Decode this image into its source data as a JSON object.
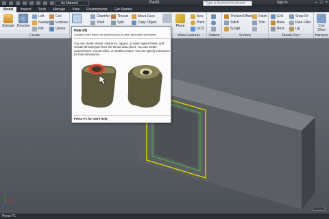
{
  "titlebar": {
    "material": "As Material",
    "document": "Part3",
    "search_placeholder": "Type a keyword or phrase",
    "sign_in": "Sign In"
  },
  "tabs": [
    "Model",
    "Inspect",
    "Tools",
    "Manage",
    "View",
    "Environments",
    "Get Started"
  ],
  "ribbon": {
    "create_title": "Create",
    "extrude": "Extrude",
    "revolve": "Revolve",
    "loft": "Loft",
    "sweep": "Sweep",
    "rib": "Rib",
    "coil": "Coil",
    "emboss": "Emboss",
    "derive": "Derive",
    "chamfer": "Chamfer",
    "thread": "Thread",
    "move_face": "Move Face",
    "shell": "Shell",
    "split": "Split",
    "copy_object": "Copy Object",
    "axis": "Axis",
    "point": "Point",
    "ucs": "UCS",
    "plane": "Plane",
    "work_features_title": "Work Features",
    "pattern_title": "Pattern",
    "thicken_offset": "Thicken/Offset",
    "stitch": "Stitch",
    "sculpt": "Sculpt",
    "patch": "Patch",
    "trim": "Trim",
    "surface_title": "Surface",
    "grill": "Grill",
    "boss": "Boss",
    "rest": "Rest",
    "snap_fit": "Snap Fit",
    "rule_fillet": "Rule Fillet",
    "lip": "Lip",
    "plastic_part_title": "Plastic Part",
    "harness_title": "Harness",
    "harness_btn1": "Con",
    "harness_btn2": "Shee"
  },
  "tooltip": {
    "title": "Hole (H)",
    "short": "Creates holes based on sketch points or other geometric selections.",
    "description": "You can create simple, clearance, tapped, or taper tapped holes, and include thread types from the thread data sheet. You can create counterbores, countersinks, or spotface holes. You can specify tolerances for hole dimensions.",
    "footer": "Press F1 for more help"
  },
  "status": "Press F1",
  "colors": {
    "part_face": "#5b5e62",
    "edge_highlight": "#d4d000",
    "inner_highlight": "#3fbf3f"
  }
}
